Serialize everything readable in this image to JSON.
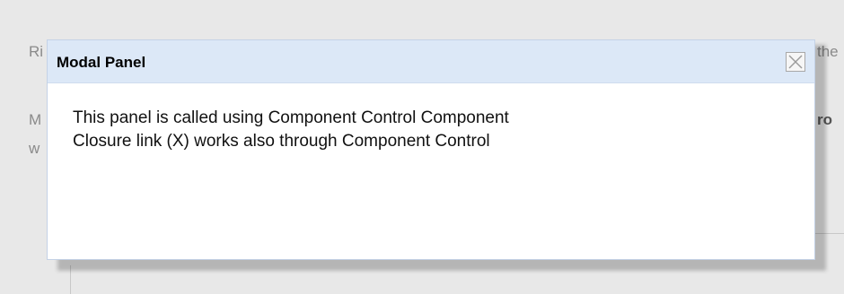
{
  "background": {
    "left_lines": [
      "Ri",
      "M",
      "w"
    ],
    "right_lines": [
      "the",
      "ro"
    ]
  },
  "modal": {
    "title": "Modal Panel",
    "close_label": "Close",
    "body_lines": [
      "This panel is called using Component Control Component",
      "Closure link (X) works also through Component Control"
    ]
  },
  "colors": {
    "header_bg": "#dce8f7",
    "modal_border": "#c4d2e6",
    "page_bg": "#e8e8e8"
  },
  "icons": {
    "close": "close-icon"
  }
}
